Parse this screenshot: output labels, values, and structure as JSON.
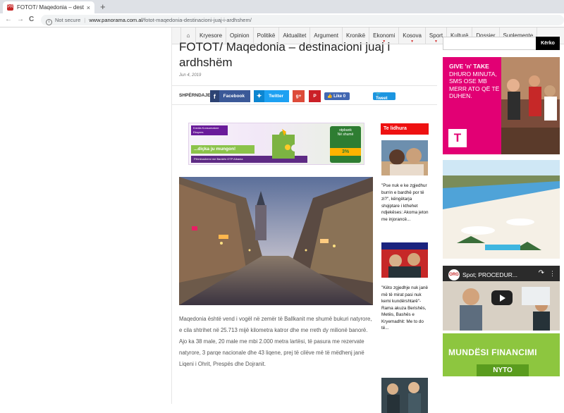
{
  "browser": {
    "tab_title": "FOTOT/ Maqedonia – destinacio",
    "tab_favicon": "PR",
    "tab_close": "×",
    "new_tab": "+",
    "back": "←",
    "forward": "→",
    "reload": "C",
    "security": "Not secure",
    "url_domain": "www.panorama.com.al",
    "url_path": "/fotot-maqedonia-destinacioni-juaj-i-ardhshem/"
  },
  "nav": {
    "home_icon": "⌂",
    "items": [
      {
        "label": "Kryesore",
        "dropdown": false
      },
      {
        "label": "Opinion",
        "dropdown": false
      },
      {
        "label": "Politikë",
        "dropdown": false
      },
      {
        "label": "Aktualitet",
        "dropdown": false
      },
      {
        "label": "Argument",
        "dropdown": false
      },
      {
        "label": "Kronikë",
        "dropdown": false
      },
      {
        "label": "Ekonomi",
        "dropdown": true
      },
      {
        "label": "Kosova",
        "dropdown": true
      },
      {
        "label": "Sport",
        "dropdown": true
      },
      {
        "label": "Kulturë",
        "dropdown": true
      },
      {
        "label": "Dossier",
        "dropdown": true
      },
      {
        "label": "Suplemente",
        "dropdown": true
      }
    ],
    "dropdown_glyph": "▼"
  },
  "article": {
    "title": "FOTOT/ Maqedonia – destinacioni juaj i ardhshëm",
    "date": "Jun 4, 2019",
    "share_label": "SHPËRNDAJE",
    "facebook": "Facebook",
    "twitter": "Twitter",
    "gplus": "g+",
    "pinterest": "P",
    "like": "👍 Like 0",
    "tweet": "🐦 Tweet",
    "body": "Maqedonia është vend i vogël në zemër të Ballkanit me shumë bukuri natyrore, e cila shtrihet në 25.713 mijë kilometra katror dhe me rreth dy milionë banorë. Ajo ka 38 male, 20 male me mbi 2.000 metra lartësi, të pasura me rezervate natyrore, 3 parqe nacionale dhe 43 liqene, prej të cilëve më të mëdhenj janë Liqeni i Ohrit, Prespës dhe Dojranit."
  },
  "ad_banner": {
    "tag": "Kredia Konsumatore Ekspres",
    "cta": "...diçka ju mungon!",
    "foot": "Përmbushemi me Bankën OTP Albania",
    "bank": "otpbank",
    "bank_line": "Në shumë",
    "pct": "3%"
  },
  "related": {
    "header": "Te lidhura",
    "items": [
      {
        "title": "\"Pse nuk e ke zgjedhur burrin e bardhë por të zi?\", këngëtarja shqiptare i kthehet ndjekëses: Akoma jeton me injorancë..."
      },
      {
        "title": "\"Këto zgjedhje nuk janë më të mirat pasi nuk kemi kundërshtarë\"- Rama akuza Berishës, Metës, Bashës e Kryemadhit: Me to do të..."
      }
    ]
  },
  "sidebar": {
    "search_placeholder": "",
    "search_button": "Kërko",
    "ad_pink_line1": "GIVE 'n' TAKE",
    "ad_pink_line2": "DHURO MINUTA, SMS OSE MB MERR ATO QË TË DUHEN.",
    "ad_pink_logo": "T",
    "video_title": "Spot; PROCEDUR...",
    "video_logo": "ORG",
    "video_share": "↷",
    "video_menu": "⋮",
    "ad_green": "MUNDËSI FINANCIMI",
    "ad_green_sub": "NYTO"
  },
  "colors": {
    "accent_red": "#ee1111",
    "facebook": "#3b5998",
    "twitter": "#1da1f2",
    "telekom_pink": "#e20074",
    "green_ad": "#8dc63f"
  }
}
